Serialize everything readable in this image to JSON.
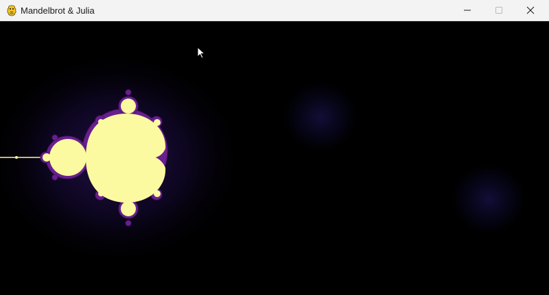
{
  "window": {
    "title": "Mandelbrot & Julia",
    "icon": "pygame-snake-icon",
    "controls": [
      "minimize",
      "maximize",
      "close"
    ]
  },
  "canvas": {
    "background": "#000000",
    "set_color": "#fcfaa0",
    "edge_color": "#6a1f8e",
    "glow_color": "#1a0b3a"
  }
}
